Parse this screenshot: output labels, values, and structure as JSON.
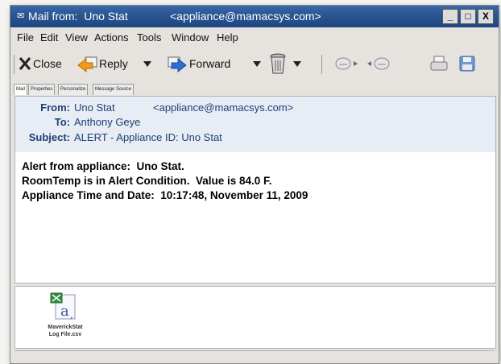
{
  "titlebar": {
    "prefix": "Mail from:  Uno Stat",
    "email": "<appliance@mamacsys.com>",
    "minimize": "_",
    "maximize": "□",
    "close": "X"
  },
  "menubar": [
    "File",
    "Edit",
    "View",
    "Actions",
    "Tools",
    "Window",
    "Help"
  ],
  "toolbar": {
    "close_label": "Close",
    "reply_label": "Reply",
    "forward_label": "Forward"
  },
  "tabs": [
    "Mail",
    "Properties",
    "Personalize",
    "Message Source"
  ],
  "header": {
    "from_label": "From:",
    "from_name": "Uno Stat",
    "from_email": "<appliance@mamacsys.com>",
    "to_label": "To:",
    "to_value": "Anthony Geye",
    "subject_label": "Subject:",
    "subject_value": "ALERT - Appliance ID: Uno Stat"
  },
  "body": {
    "line1": "Alert from appliance:  Uno Stat.",
    "line2": "RoomTemp is in Alert Condition.  Value is 84.0 F.",
    "line3": "Appliance Time and Date:  10:17:48, November 11, 2009"
  },
  "attachment": {
    "name_line1": "MaverickStat",
    "name_line2": "Log File.csv",
    "icon": "csv-file-icon"
  },
  "colors": {
    "titlebar": "#2a5592",
    "header_bg": "#e7ecf5",
    "header_text": "#1f3f74"
  }
}
